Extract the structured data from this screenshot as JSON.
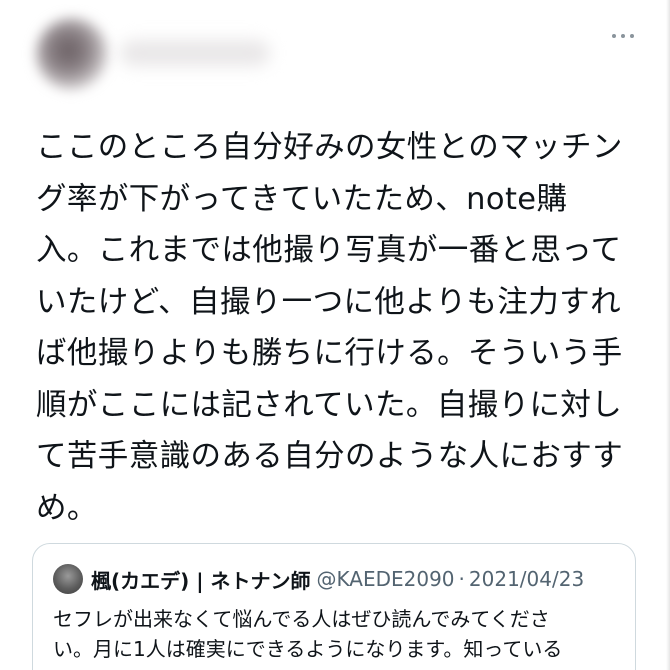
{
  "tweet": {
    "lines": [
      "ここのところ自分好みの女性とのマッチン",
      "グ率が下がってきていたため、note購",
      "入。これまでは他撮り写真が一番と思って",
      "いたけど、自撮り一つに他よりも注力すれ",
      "ば他撮りよりも勝ちに行ける。そういう手",
      "順がここには記されていた。自撮りに対し",
      "て苦手意識のある自分のような人におすす",
      "め。"
    ]
  },
  "quote": {
    "name": "楓(カエデ) | ネトナン師",
    "handle": "@KAEDE2090",
    "separator": "·",
    "date": "2021/04/23",
    "lines": [
      "セフレが出来なくて悩んでる人はぜひ読んでみてくださ",
      "い。月に1人は確実にできるようになります。知っている"
    ]
  },
  "icons": {
    "more": "more-horizontal-icon"
  },
  "colors": {
    "text_primary": "#0f1419",
    "text_secondary": "#536471",
    "card_border": "#cfd9de"
  }
}
